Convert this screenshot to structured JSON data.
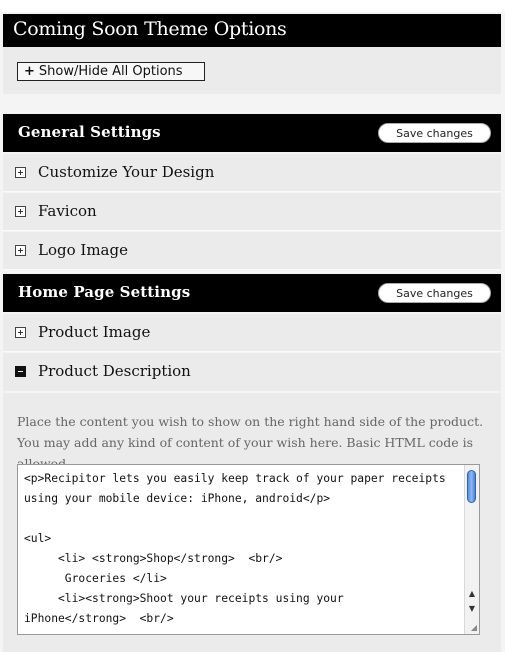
{
  "page_title": "Coming Soon Theme Options",
  "show_hide": {
    "plus": "+",
    "label": "Show/Hide All Options"
  },
  "general": {
    "title": "General Settings",
    "save_label": "Save changes",
    "items": [
      {
        "label": "Customize Your Design",
        "state": "collapsed"
      },
      {
        "label": "Favicon",
        "state": "collapsed"
      },
      {
        "label": "Logo Image",
        "state": "collapsed"
      }
    ]
  },
  "home": {
    "title": "Home Page Settings",
    "save_label": "Save changes",
    "items": [
      {
        "label": "Product Image",
        "state": "collapsed"
      },
      {
        "label": "Product Description",
        "state": "expanded"
      }
    ]
  },
  "product_description": {
    "help": "Place the content you wish to show on the right hand side of the product. You may add any kind of content of your wish here. Basic HTML code is allowed.",
    "value": "<p>Recipitor lets you easily keep track of your paper receipts\nusing your mobile device: iPhone, android</p>\n\n<ul>\n     <li> <strong>Shop</strong>  <br/>\n      Groceries </li>\n     <li><strong>Shoot your receipts using your\niPhone</strong>  <br/>"
  },
  "scroll": {
    "up_arrow": "▲",
    "down_arrow": "▼",
    "resize_grip": "◢"
  }
}
